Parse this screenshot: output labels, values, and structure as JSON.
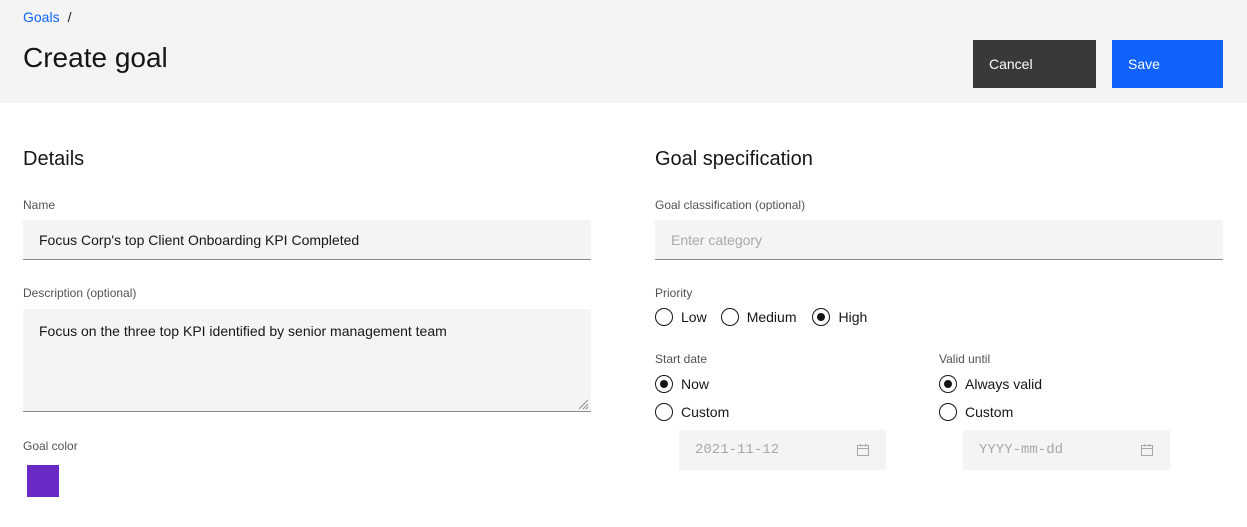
{
  "breadcrumb": {
    "root": "Goals",
    "separator": "/"
  },
  "page": {
    "title": "Create goal"
  },
  "actions": {
    "cancel": "Cancel",
    "save": "Save"
  },
  "details": {
    "title": "Details",
    "name_label": "Name",
    "name_value": "Focus Corp's top Client Onboarding KPI Completed",
    "description_label": "Description (optional)",
    "description_value": "Focus on the three top KPI identified by senior management team",
    "color_label": "Goal color",
    "color_value": "#6929c4"
  },
  "spec": {
    "title": "Goal specification",
    "classification_label": "Goal classification (optional)",
    "classification_placeholder": "Enter category",
    "priority_label": "Priority",
    "priority_options": [
      "Low",
      "Medium",
      "High"
    ],
    "priority_selected": "High",
    "start_label": "Start date",
    "start_options": [
      "Now",
      "Custom"
    ],
    "start_selected": "Now",
    "start_date": "2021-11-12",
    "valid_label": "Valid until",
    "valid_options": [
      "Always valid",
      "Custom"
    ],
    "valid_selected": "Always valid",
    "valid_date_placeholder": "YYYY-mm-dd"
  },
  "icons": {
    "calendar": "calendar-icon",
    "resize": "resize-handle-icon"
  },
  "colors": {
    "accent": "#0f62fe",
    "secondary": "#393939",
    "swatch": "#6929c4"
  }
}
